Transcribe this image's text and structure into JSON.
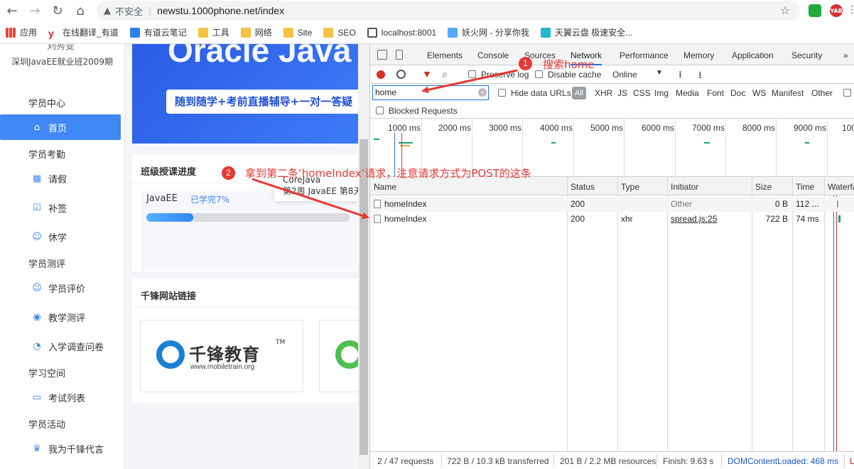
{
  "browser": {
    "security_label": "不安全",
    "url": "newstu.1000phone.net/index",
    "ext1": "",
    "ext2": "YAB",
    "bookmarks": [
      {
        "label": "应用",
        "icon": "apps-icon"
      },
      {
        "label": "在线翻译_有道",
        "icon": "youdao-icon"
      },
      {
        "label": "有道云笔记",
        "icon": "note-icon"
      },
      {
        "label": "工具",
        "icon": "folder-icon"
      },
      {
        "label": "网络",
        "icon": "folder-icon"
      },
      {
        "label": "Site",
        "icon": "folder-icon"
      },
      {
        "label": "SEO",
        "icon": "folder-icon"
      },
      {
        "label": "localhost:8001",
        "icon": "globe-icon"
      },
      {
        "label": "妖火网 - 分享你我",
        "icon": "chat-icon"
      },
      {
        "label": "天翼云盘 极速安全...",
        "icon": "cloud-icon"
      }
    ]
  },
  "sidebar": {
    "user_name": "刘秀变",
    "class_name": "深圳JavaEE就业班2009期",
    "sections": [
      {
        "title": "学员中心",
        "items": [
          {
            "label": "首页",
            "icon": "home-icon",
            "active": true
          }
        ]
      },
      {
        "title": "学员考勤",
        "items": [
          {
            "label": "请假",
            "icon": "calendar-icon"
          },
          {
            "label": "补签",
            "icon": "check-calendar-icon"
          },
          {
            "label": "休学",
            "icon": "person-icon"
          }
        ]
      },
      {
        "title": "学员测评",
        "items": [
          {
            "label": "学员评价",
            "icon": "smile-icon"
          },
          {
            "label": "教学测评",
            "icon": "target-icon"
          },
          {
            "label": "入学调查问卷",
            "icon": "survey-icon"
          }
        ]
      },
      {
        "title": "学习空间",
        "items": [
          {
            "label": "考试列表",
            "icon": "exam-icon"
          }
        ]
      },
      {
        "title": "学员活动",
        "items": [
          {
            "label": "我为千锋代言",
            "icon": "crown-icon"
          }
        ]
      }
    ]
  },
  "main": {
    "banner_title": "Oracle Java",
    "banner_slogan": "随到随学+考前直播辅导+一对一答疑",
    "progress_card": {
      "title": "班级授课进度",
      "course": "JavaEE",
      "percent_label": "已学完7%",
      "percent": 0.07,
      "tooltip_line1": "CoreJava",
      "tooltip_line2": "第2周 JavaEE 第8天"
    },
    "links_card": {
      "title": "千锋网站链接",
      "logo_text": "千锋教育",
      "logo_tm": "TM",
      "logo_url": "www.mobiletrain.org"
    }
  },
  "devtools": {
    "tabs": [
      "Elements",
      "Console",
      "Sources",
      "Network",
      "Performance",
      "Memory",
      "Application",
      "Security"
    ],
    "active_tab": "Network",
    "more_tabs": "»",
    "toolbar": {
      "preserve_log": "Preserve log",
      "disable_cache": "Disable cache",
      "throttle": "Online"
    },
    "filter": {
      "value": "home",
      "hide_data_urls": "Hide data URLs",
      "types": [
        "All",
        "XHR",
        "JS",
        "CSS",
        "Img",
        "Media",
        "Font",
        "Doc",
        "WS",
        "Manifest",
        "Other"
      ],
      "blocked_requests": "Blocked Requests"
    },
    "overview_ticks": [
      "1000 ms",
      "2000 ms",
      "3000 ms",
      "4000 ms",
      "5000 ms",
      "6000 ms",
      "7000 ms",
      "8000 ms",
      "9000 ms",
      "100"
    ],
    "columns": [
      "Name",
      "Status",
      "Type",
      "Initiator",
      "Size",
      "Time",
      "Waterfall"
    ],
    "rows": [
      {
        "name": "homeIndex",
        "status": "200",
        "type": "",
        "initiator": "Other",
        "size": "0 B",
        "time": "112 ..."
      },
      {
        "name": "homeIndex",
        "status": "200",
        "type": "xhr",
        "initiator": "spread.js:25",
        "size": "722 B",
        "time": "74 ms"
      }
    ],
    "status": {
      "requests": "2 / 47 requests",
      "transferred": "722 B / 10.3 kB transferred",
      "resources": "201 B / 2.2 MB resources",
      "finish": "Finish: 9.63 s",
      "dcl": "DOMContentLoaded: 468 ms",
      "load": "L"
    }
  },
  "annotations": [
    {
      "number": "1",
      "text": "搜索home"
    },
    {
      "number": "2",
      "text": "拿到第二条‘homeIndex’请求，注意请求方式为POST的这条"
    }
  ],
  "colors": {
    "accent": "#3f88f5",
    "annotation": "#e53935",
    "devtools_active": "#1a73e8"
  }
}
